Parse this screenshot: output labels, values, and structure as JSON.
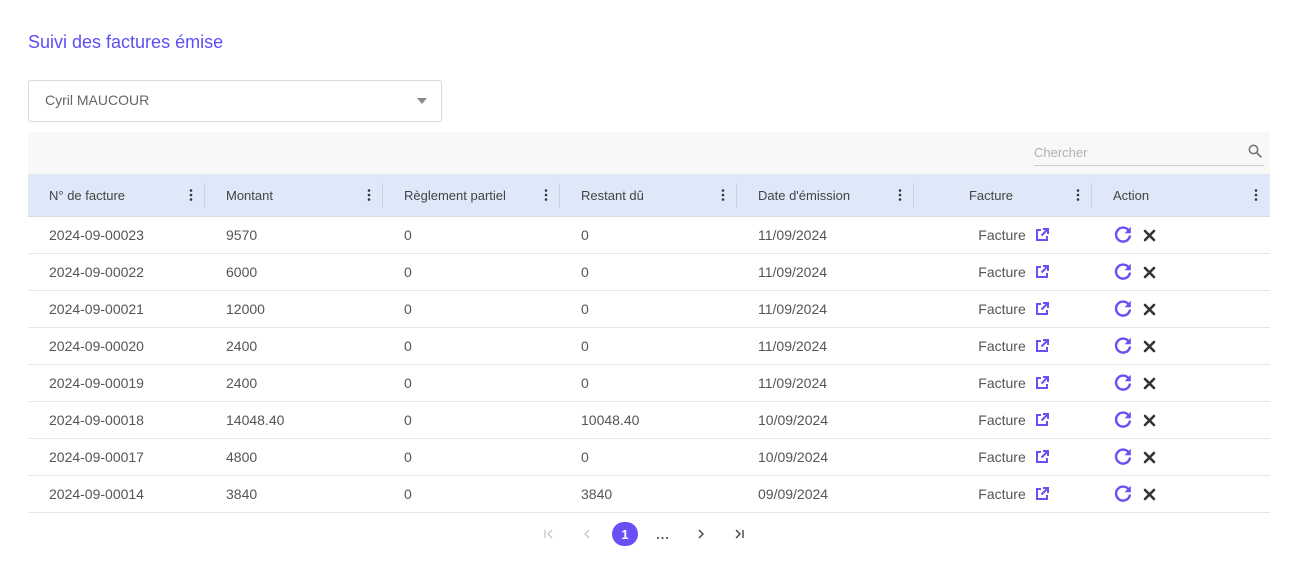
{
  "page": {
    "title": "Suivi des factures émise"
  },
  "client_select": {
    "value": "Cyril MAUCOUR"
  },
  "search": {
    "placeholder": "Chercher"
  },
  "table": {
    "columns": [
      "N° de facture",
      "Montant",
      "Règlement partiel",
      "Restant dû",
      "Date d'émission",
      "Facture",
      "Action"
    ],
    "rows": [
      {
        "numero": "2024-09-00023",
        "montant": "9570",
        "reglement": "0",
        "restant": "0",
        "date": "11/09/2024",
        "facture": "Facture"
      },
      {
        "numero": "2024-09-00022",
        "montant": "6000",
        "reglement": "0",
        "restant": "0",
        "date": "11/09/2024",
        "facture": "Facture"
      },
      {
        "numero": "2024-09-00021",
        "montant": "12000",
        "reglement": "0",
        "restant": "0",
        "date": "11/09/2024",
        "facture": "Facture"
      },
      {
        "numero": "2024-09-00020",
        "montant": "2400",
        "reglement": "0",
        "restant": "0",
        "date": "11/09/2024",
        "facture": "Facture"
      },
      {
        "numero": "2024-09-00019",
        "montant": "2400",
        "reglement": "0",
        "restant": "0",
        "date": "11/09/2024",
        "facture": "Facture"
      },
      {
        "numero": "2024-09-00018",
        "montant": "14048.40",
        "reglement": "0",
        "restant": "10048.40",
        "date": "10/09/2024",
        "facture": "Facture"
      },
      {
        "numero": "2024-09-00017",
        "montant": "4800",
        "reglement": "0",
        "restant": "0",
        "date": "10/09/2024",
        "facture": "Facture"
      },
      {
        "numero": "2024-09-00014",
        "montant": "3840",
        "reglement": "0",
        "restant": "3840",
        "date": "09/09/2024",
        "facture": "Facture"
      }
    ]
  },
  "pagination": {
    "current": "1",
    "ellipsis": "..."
  },
  "colors": {
    "accent": "#6a4ff5",
    "title": "#5b4ff5",
    "header_bg": "#dfe8f9"
  },
  "icons": {
    "dropdown": "chevron-down-icon",
    "search": "search-icon",
    "column_menu": "kebab-menu-icon",
    "open_invoice": "external-link-icon",
    "regenerate": "refresh-icon",
    "delete": "close-icon"
  }
}
